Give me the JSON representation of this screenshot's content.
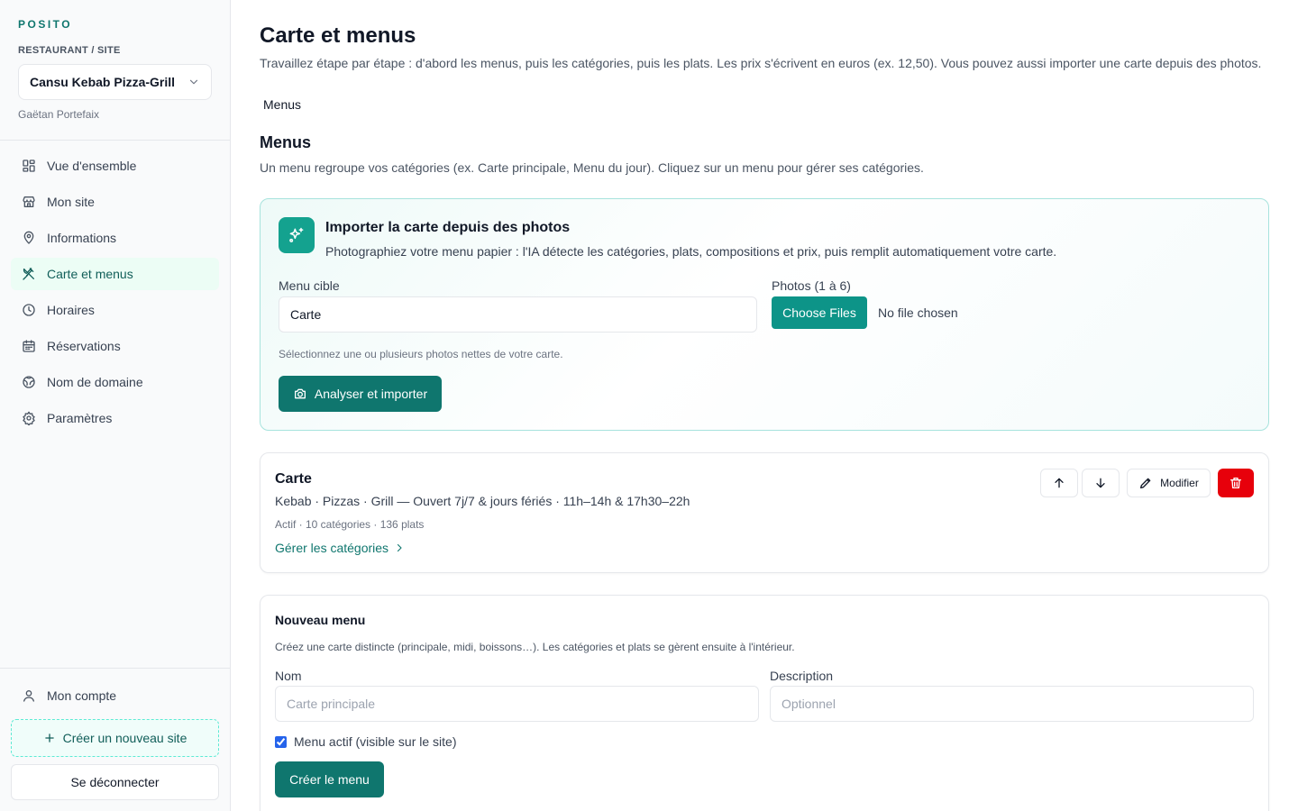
{
  "sidebar": {
    "brand": "POSITO",
    "site_label": "RESTAURANT / SITE",
    "site_selected": "Cansu Kebab Pizza-Grill",
    "owner": "Gaëtan Portefaix",
    "nav": [
      {
        "label": "Vue d'ensemble",
        "icon": "dashboard-icon"
      },
      {
        "label": "Mon site",
        "icon": "store-icon"
      },
      {
        "label": "Informations",
        "icon": "map-pin-icon"
      },
      {
        "label": "Carte et menus",
        "icon": "utensils-icon",
        "active": true
      },
      {
        "label": "Horaires",
        "icon": "clock-icon"
      },
      {
        "label": "Réservations",
        "icon": "calendar-icon"
      },
      {
        "label": "Nom de domaine",
        "icon": "globe-icon"
      },
      {
        "label": "Paramètres",
        "icon": "gear-icon"
      }
    ],
    "account_label": "Mon compte",
    "new_site_label": "Créer un nouveau site",
    "logout_label": "Se déconnecter"
  },
  "main": {
    "title": "Carte et menus",
    "description": "Travaillez étape par étape : d'abord les menus, puis les catégories, puis les plats. Les prix s'écrivent en euros (ex. 12,50). Vous pouvez aussi importer une carte depuis des photos.",
    "breadcrumb": "Menus",
    "section_title": "Menus",
    "section_desc": "Un menu regroupe vos catégories (ex. Carte principale, Menu du jour). Cliquez sur un menu pour gérer ses catégories."
  },
  "import": {
    "title": "Importer la carte depuis des photos",
    "description": "Photographiez votre menu papier : l'IA détecte les catégories, plats, compositions et prix, puis remplit automatiquement votre carte.",
    "target_label": "Menu cible",
    "target_value": "Carte",
    "photos_label": "Photos (1 à 6)",
    "choose_files": "Choose Files",
    "no_file": "No file chosen",
    "hint": "Sélectionnez une ou plusieurs photos nettes de votre carte.",
    "analyze_label": "Analyser et importer"
  },
  "menu": {
    "name": "Carte",
    "description": "Kebab · Pizzas · Grill — Ouvert 7j/7 & jours fériés · 11h–14h & 17h30–22h",
    "meta": "Actif · 10 catégories · 136 plats",
    "manage_link": "Gérer les catégories",
    "edit_label": "Modifier"
  },
  "new_menu": {
    "title": "Nouveau menu",
    "description": "Créez une carte distincte (principale, midi, boissons…). Les catégories et plats se gèrent ensuite à l'intérieur.",
    "name_label": "Nom",
    "name_placeholder": "Carte principale",
    "desc_label": "Description",
    "desc_placeholder": "Optionnel",
    "active_label": "Menu actif (visible sur le site)",
    "active_checked": true,
    "create_label": "Créer le menu"
  },
  "colors": {
    "accent": "#0f766e",
    "accent_light": "#14a28f",
    "danger": "#e7000b"
  }
}
